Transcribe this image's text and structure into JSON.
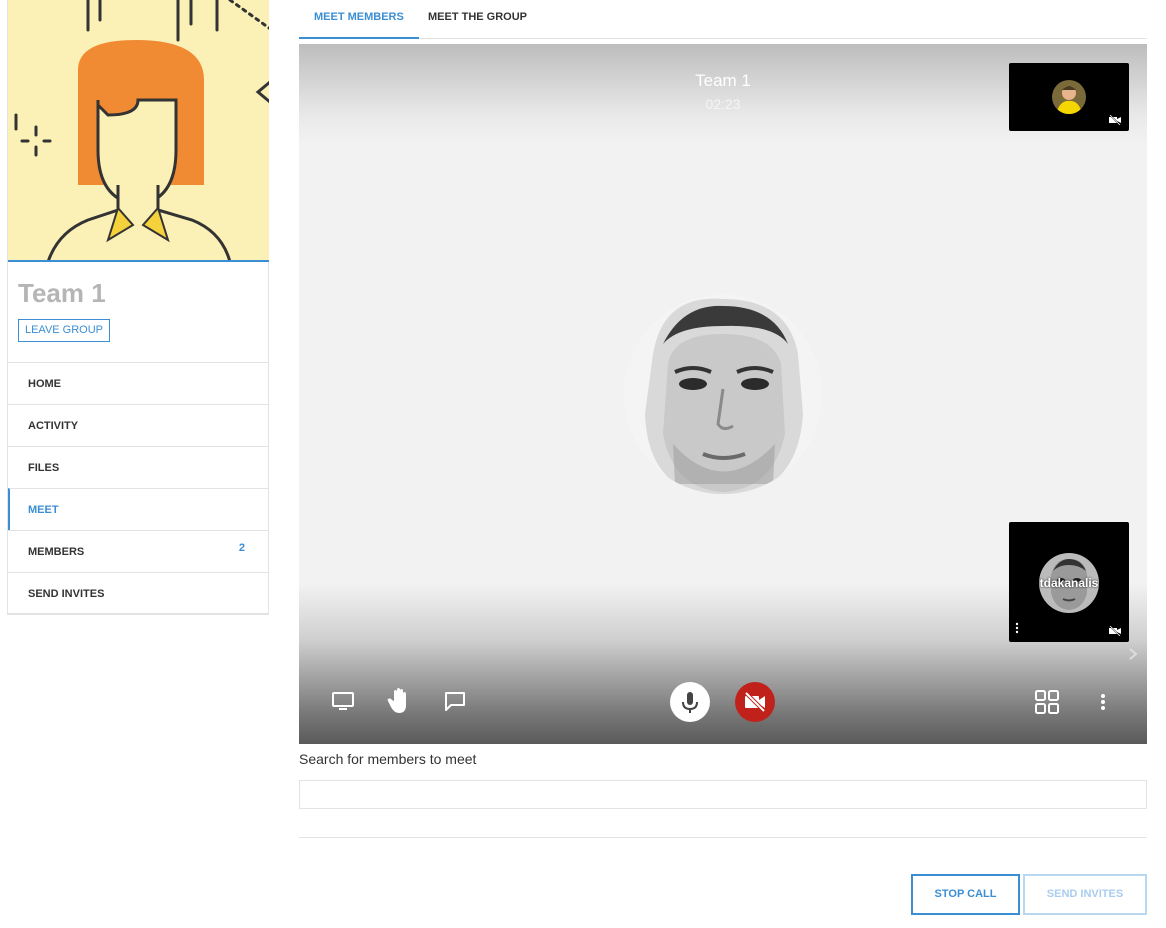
{
  "group": {
    "name": "Team 1",
    "leave_label": "LEAVE GROUP"
  },
  "nav": {
    "items": [
      {
        "label": "HOME"
      },
      {
        "label": "ACTIVITY"
      },
      {
        "label": "FILES"
      },
      {
        "label": "MEET",
        "active": true
      },
      {
        "label": "MEMBERS",
        "count": "2"
      },
      {
        "label": "SEND INVITES"
      }
    ]
  },
  "tabs": [
    {
      "label": "MEET MEMBERS",
      "active": true
    },
    {
      "label": "MEET THE GROUP"
    }
  ],
  "call": {
    "title": "Team 1",
    "time": "02:23",
    "participant_name": "tdakanalis"
  },
  "search": {
    "label": "Search for members to meet",
    "value": "",
    "placeholder": ""
  },
  "actions": {
    "stop_call": "STOP CALL",
    "send_invites": "SEND INVITES"
  },
  "icons": {
    "screen_share": "monitor-icon",
    "raise_hand": "hand-icon",
    "chat": "chat-icon",
    "mic": "microphone-icon",
    "camera_off": "video-off-icon",
    "layout": "grid-icon",
    "more": "kebab-icon"
  },
  "colors": {
    "accent": "#3b8ed3",
    "camera_off_button": "#c0221b",
    "avatar_background": "#fbf1b6",
    "avatar_hair": "#f08b34"
  }
}
